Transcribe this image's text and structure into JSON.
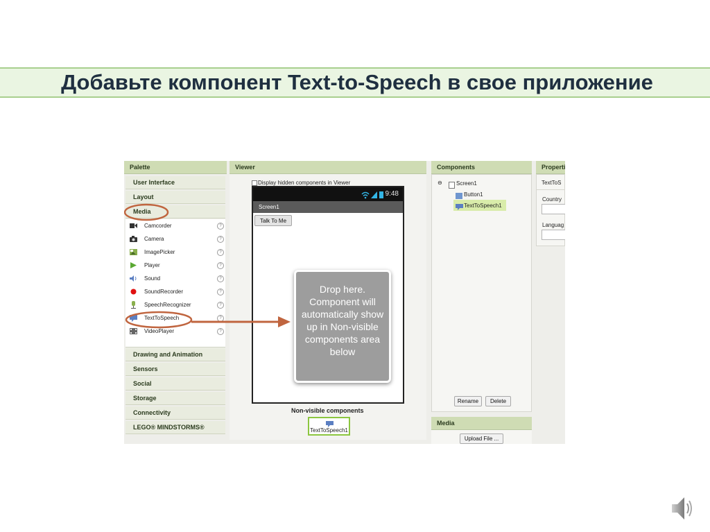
{
  "slide": {
    "title": "Добавьте компонент Text-to-Speech в свое приложение"
  },
  "palette": {
    "header": "Palette",
    "categories_top": [
      "User Interface",
      "Layout",
      "Media"
    ],
    "media_items": [
      "Camcorder",
      "Camera",
      "ImagePicker",
      "Player",
      "Sound",
      "SoundRecorder",
      "SpeechRecognizer",
      "TextToSpeech",
      "VideoPlayer"
    ],
    "help_glyph": "?",
    "categories_bottom": [
      "Drawing and Animation",
      "Sensors",
      "Social",
      "Storage",
      "Connectivity",
      "LEGO® MINDSTORMS®"
    ]
  },
  "viewer": {
    "header": "Viewer",
    "checkbox_label": "Display hidden components in Viewer",
    "checkbox_checked": false,
    "phone_time": "9:48",
    "screen_title": "Screen1",
    "button_label": "Talk To Me",
    "drop_hint": "Drop here. Component will automatically show up in Non-visible components area below",
    "nonvisible_title": "Non-visible components",
    "nonvisible_item": "TextToSpeech1"
  },
  "components": {
    "header": "Components",
    "collapse_glyph": "⊖",
    "tree": [
      "Screen1",
      "Button1",
      "TextToSpeech1"
    ],
    "rename_label": "Rename",
    "delete_label": "Delete"
  },
  "media_panel": {
    "header": "Media",
    "upload_label": "Upload File ..."
  },
  "properties": {
    "header": "Properti",
    "component": "TextToS",
    "fields": [
      "Country",
      "Languag"
    ]
  },
  "colors": {
    "accent_orange": "#c0653f",
    "header_green": "#cfdcb4",
    "title_band": "#eaf5e2"
  }
}
